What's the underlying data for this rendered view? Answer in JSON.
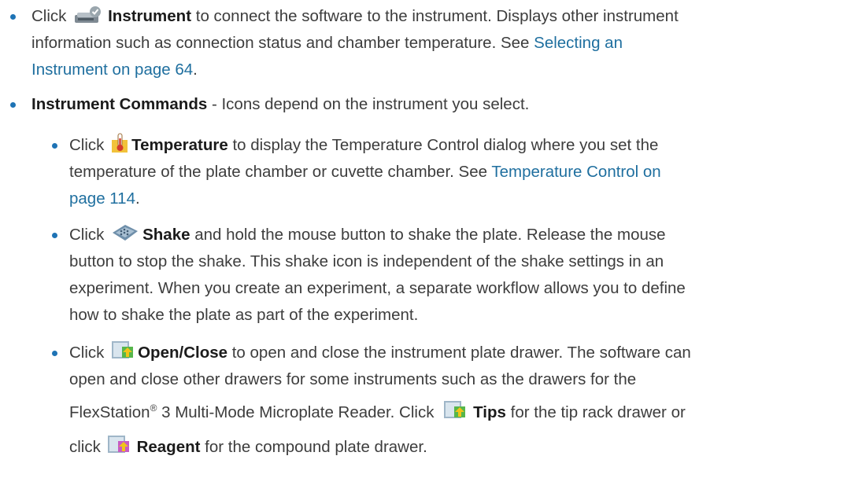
{
  "items": [
    {
      "prefix": "Click ",
      "bold": "Instrument",
      "text1": " to connect the software to the instrument. Displays other instrument",
      "text2": "information such as connection status and chamber temperature. See ",
      "link_part1": "Selecting an",
      "link_part2": "Instrument on page 64",
      "suffix": "."
    },
    {
      "bold": "Instrument Commands",
      "text": " - Icons depend on the instrument you select."
    }
  ],
  "subitems": [
    {
      "prefix": "Click ",
      "bold": "Temperature",
      "text1": " to display the Temperature Control dialog where you set the",
      "text2": "temperature of the plate chamber or cuvette chamber. See ",
      "link_part1": "Temperature Control on",
      "link_part2": "page 114",
      "suffix": "."
    },
    {
      "prefix": "Click ",
      "bold": "Shake",
      "text1": " and hold the mouse button to shake the plate. Release the mouse",
      "text2": "button to stop the shake. This shake icon is independent of the shake settings in an",
      "text3": "experiment. When you create an experiment, a separate workflow allows you to define",
      "text4": "how to shake the plate as part of the experiment."
    },
    {
      "prefix": "Click ",
      "bold": "Open/Close",
      "text1": " to open and close the instrument plate drawer. The software can",
      "text2": "open and close other drawers for some instruments such as the drawers for the",
      "text3a": "FlexStation",
      "text3reg": "®",
      "text3b": " 3 Multi-Mode Microplate Reader. Click ",
      "tips_bold": "Tips",
      "text3c": " for the tip rack drawer or",
      "text4a": "click ",
      "reagent_bold": "Reagent",
      "text4b": " for the compound plate drawer."
    }
  ],
  "icons": {
    "instrument": "instrument-icon",
    "temperature": "thermometer-icon",
    "shake": "shake-icon",
    "open_close": "drawer-icon",
    "tips": "tips-drawer-icon",
    "reagent": "reagent-drawer-icon"
  },
  "colors": {
    "bullet": "#1e73b5",
    "link": "#1f6f9f",
    "text": "#3d3d3d"
  }
}
